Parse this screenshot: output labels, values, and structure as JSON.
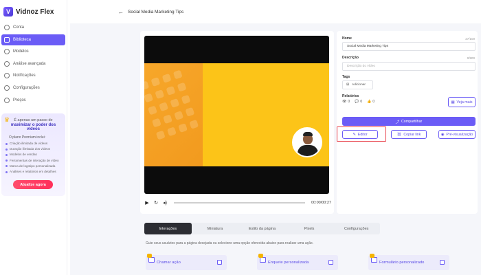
{
  "app": {
    "logo_text": "Vidnoz Flex"
  },
  "sidebar": {
    "items": [
      {
        "label": "Conta",
        "icon": "user-circle-icon",
        "active": false
      },
      {
        "label": "Biblioteca",
        "icon": "library-icon",
        "active": true
      },
      {
        "label": "Modelos",
        "icon": "templates-icon",
        "active": false
      },
      {
        "label": "Análise avançada",
        "icon": "analytics-icon",
        "active": false
      },
      {
        "label": "Notificações",
        "icon": "bell-icon",
        "active": false
      },
      {
        "label": "Configurações",
        "icon": "gear-icon",
        "active": false
      },
      {
        "label": "Preços",
        "icon": "price-icon",
        "active": false
      }
    ],
    "promo": {
      "line1": "É apenas um passo de",
      "line2": "maximizar o poder dos vídeos",
      "plan_intro": "O plano Premium inclui:",
      "features": [
        "Criação ilimitada de vídeos",
        "Duração ilimitada dos vídeos",
        "Modelos de vendas",
        "Ferramentas de interação de vídeo",
        "Marca de logotipo personalizada",
        "Análises e relatórios em detalhes"
      ],
      "button": "Atualize agora"
    }
  },
  "header": {
    "back_icon": "arrow-left-icon",
    "title": "Social Media Marketing Tips"
  },
  "player": {
    "time": "00:00/00:27",
    "play_icon": "play-icon",
    "replay_icon": "replay-icon",
    "volume_icon": "volume-icon"
  },
  "details": {
    "name_label": "Nome",
    "name_count": "27/100",
    "name_value": "Social Media Marketing Tips",
    "desc_label": "Descrição",
    "desc_count": "0/800",
    "desc_placeholder": "Descrição do vídeo",
    "tags_label": "Tags",
    "tags_add": "Adicionar",
    "reports_label": "Relatórios",
    "stats": {
      "views": "0",
      "comments": "0",
      "likes": "0"
    },
    "more_button": "Veja mais",
    "share_button": "Compartilhar",
    "editor_button": "Editor",
    "copy_link_button": "Copiar link",
    "preview_button": "Pré-visualização"
  },
  "tabs": [
    {
      "label": "Interações",
      "active": true
    },
    {
      "label": "Miniatura",
      "active": false
    },
    {
      "label": "Estilo da página",
      "active": false
    },
    {
      "label": "Pixels",
      "active": false
    },
    {
      "label": "Configurações",
      "active": false
    }
  ],
  "hint": "Guie seus usuários para a página desejada ou selecione uma opção oferecida abaixo para realizar uma ação.",
  "options": [
    {
      "label": "Chamar ação"
    },
    {
      "label": "Enquete personalizada"
    },
    {
      "label": "Formulário personalizado"
    }
  ],
  "colors": {
    "accent": "#6b5cf6",
    "video_bg": "#fcc418",
    "highlight": "#e8404a",
    "upgrade": "#ff2f5a"
  }
}
